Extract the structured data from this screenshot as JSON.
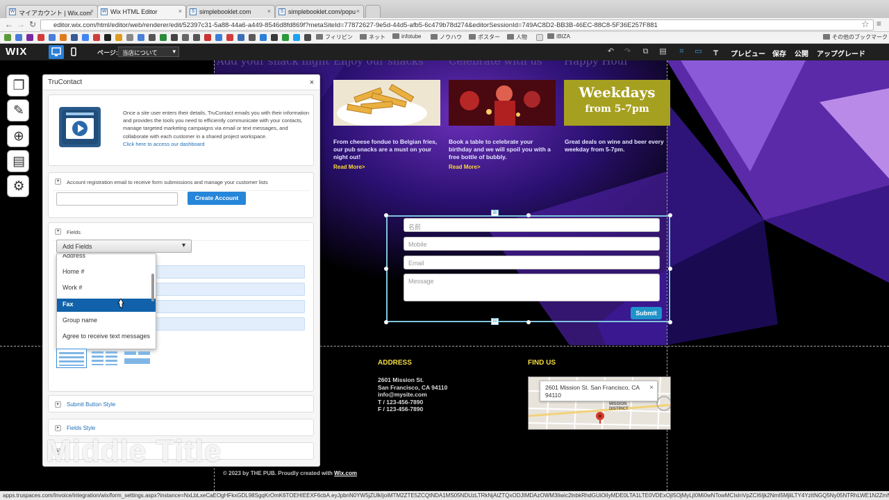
{
  "browser": {
    "tabs": [
      {
        "label": "マイアカウント | Wix.com",
        "favicon": "W"
      },
      {
        "label": "Wix HTML Editor",
        "favicon": "W"
      },
      {
        "label": "simplebooklet.com",
        "favicon": "S"
      },
      {
        "label": "simplebooklet.com/popu",
        "favicon": "S"
      }
    ],
    "url": "editor.wix.com/html/editor/web/renderer/edit/52397c31-5a88-44a6-a449-8546d8fd869f?metaSiteId=77872627-9e5d-44d5-afb5-6c479b78d274&editorSessionId=749AC8D2-BB3B-46EC-88C8-5F36E257F881",
    "bookmarks": [
      "フィリピン",
      "ネット",
      "infotube",
      "ノウハウ",
      "ポスター",
      "人物",
      "IBIZA"
    ],
    "other_bookmarks": "その他のブックマーク",
    "status_url": "apps.truspaces.com/Invoice/integration/wix/form_settings.aspx?instance=NxLbLxeCaEOgHFkxGDL98SgqKrOmK6TOEHIEEXF6cbA.eyJpbnN0YW5jZUlkIjoiMTM2ZTE5ZCQtNDA1MS05NDUzLTRkNjAtZTQxODJIMDAzOWM3Iiwic2lnbkRhdGUiOiIyMDE0LTA1LTE0VDExOjI5OjMyLjI0Mi0wNTowMCIsInVpZCI6Ijk2NmI5MjliLTY4YzItNGQ5Ny05NTRhLWE1N2ZmN2NkkNmY"
  },
  "wix_toolbar": {
    "logo": "WIX",
    "page_label": "ページ:",
    "page_select": "当店について",
    "menu": [
      "プレビュー",
      "保存",
      "公開",
      "アップグレード"
    ]
  },
  "site": {
    "ghost_headers": [
      "Add your snack night",
      "Enjoy our snacks",
      "Celebrate with us",
      "Happy Hour"
    ],
    "columns": [
      {
        "text": "From cheese fondue to Belgian fries, our pub snacks are a must on your night out!",
        "link": "Read More>"
      },
      {
        "text": "Book a table to celebrate your birthday and we will spoil you with a free bottle of bubbly.",
        "link": "Read More>"
      },
      {
        "text": "Great deals on wine and beer every weekday from 5-7pm.",
        "link": ""
      }
    ],
    "weekdays_title": "Weekdays",
    "weekdays_sub": "from 5-7pm",
    "form": {
      "name_placeholder": "名前",
      "mobile_placeholder": "Mobile",
      "email_placeholder": "Email",
      "message_placeholder": "Message",
      "submit": "Submit"
    },
    "footer": {
      "address_title": "ADDRESS",
      "address_lines": [
        "2601 Mission St.",
        "San Francisco, CA 94110",
        "info@mysite.com",
        "T  /  123-456-7890",
        "F  /  123-456-7890"
      ],
      "find_title": "FIND US",
      "map_bubble": "2601 Mission St. San Francisco, CA 94110",
      "map_district": "MISSION DISTRICT",
      "copyright": "© 2023 by  THE PUB. Proudly created with ",
      "wix_link": "Wix.com"
    }
  },
  "panel": {
    "title": "TruContact",
    "intro": "Once a site user enters their details, TruContact emails you with their information and provides the tools you need to efficiently communicate with your contacts, manage targeted marketing campaigns via email or text messages, and collaborate with each customer in a shared project workspace.",
    "intro_link": "Click here to access our dashboard",
    "account_text": "Account registration email to receive form submissions and manage your customer lists",
    "create_button": "Create Account",
    "fields_label": "Fields",
    "add_fields": "Add Fields",
    "dropdown_items": [
      "Address",
      "Home #",
      "Work #",
      "Fax",
      "Group name",
      "Agree to receive text messages"
    ],
    "selected_item": "Fax",
    "submit_style": "Submit Button Style",
    "fields_style": "Fields Style"
  },
  "overlay_title": "Middle Title"
}
